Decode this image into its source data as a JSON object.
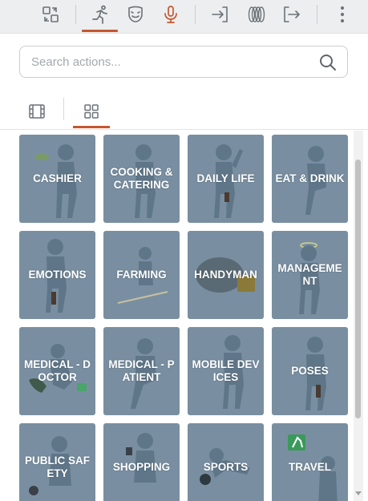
{
  "toolbar": {
    "buttons": [
      {
        "name": "swap-icon"
      },
      {
        "name": "running-person-icon",
        "active": true
      },
      {
        "name": "theater-mask-icon"
      },
      {
        "name": "microphone-icon"
      },
      {
        "name": "enter-icon"
      },
      {
        "name": "rings-icon"
      },
      {
        "name": "exit-icon"
      },
      {
        "name": "more-vertical-icon"
      }
    ],
    "accent_color": "#c5572f"
  },
  "search": {
    "placeholder": "Search actions...",
    "value": ""
  },
  "view_tabs": [
    {
      "name": "film-icon",
      "active": false
    },
    {
      "name": "grid-icon",
      "active": true
    }
  ],
  "categories": [
    "CASHIER",
    "COOKING & CATERING",
    "DAILY LIFE",
    "EAT & DRINK",
    "EMOTIONS",
    "FARMING",
    "HANDYMAN",
    "MANAGEMENT",
    "MEDICAL - DOCTOR",
    "MEDICAL - PATIENT",
    "MOBILE DEVICES",
    "POSES",
    "PUBLIC SAFETY",
    "SHOPPING",
    "SPORTS",
    "TRAVEL"
  ],
  "tile_color": "#798fa1"
}
